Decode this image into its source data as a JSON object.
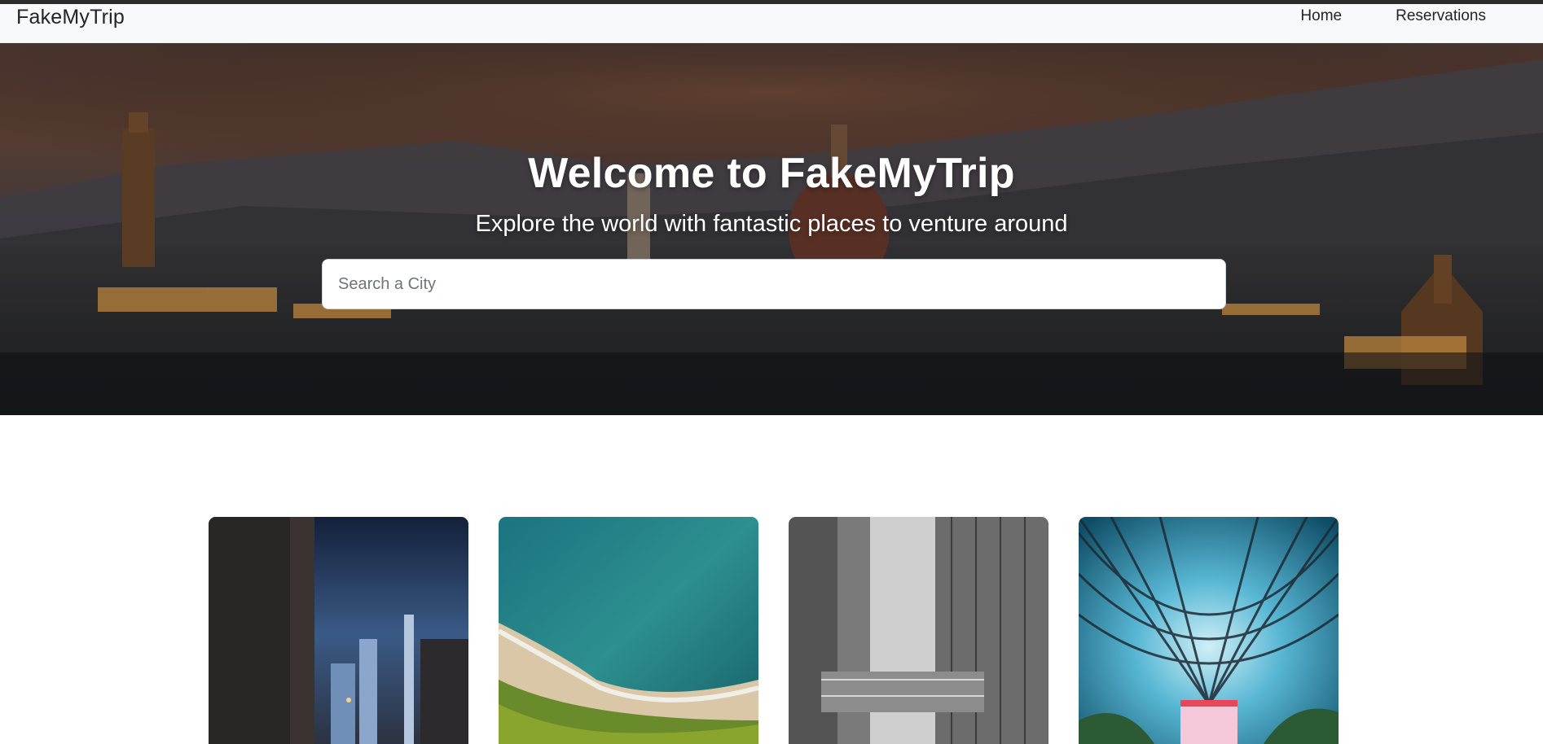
{
  "navbar": {
    "brand": "FakeMyTrip",
    "links": [
      {
        "label": "Home"
      },
      {
        "label": "Reservations"
      }
    ]
  },
  "hero": {
    "title": "Welcome to FakeMyTrip",
    "subtitle": "Explore the world with fantastic places to venture around",
    "search": {
      "placeholder": "Search a City",
      "value": ""
    }
  },
  "cards": [
    {
      "image": "city-street-night-photo"
    },
    {
      "image": "aerial-beach-coast-photo"
    },
    {
      "image": "skyscrapers-skybridge-photo"
    },
    {
      "image": "glass-dome-waterfall-photo"
    }
  ],
  "colors": {
    "navbar_bg": "#f8f9fa",
    "text": "#212529",
    "hero_overlay": "#2a2a30",
    "white": "#ffffff"
  }
}
